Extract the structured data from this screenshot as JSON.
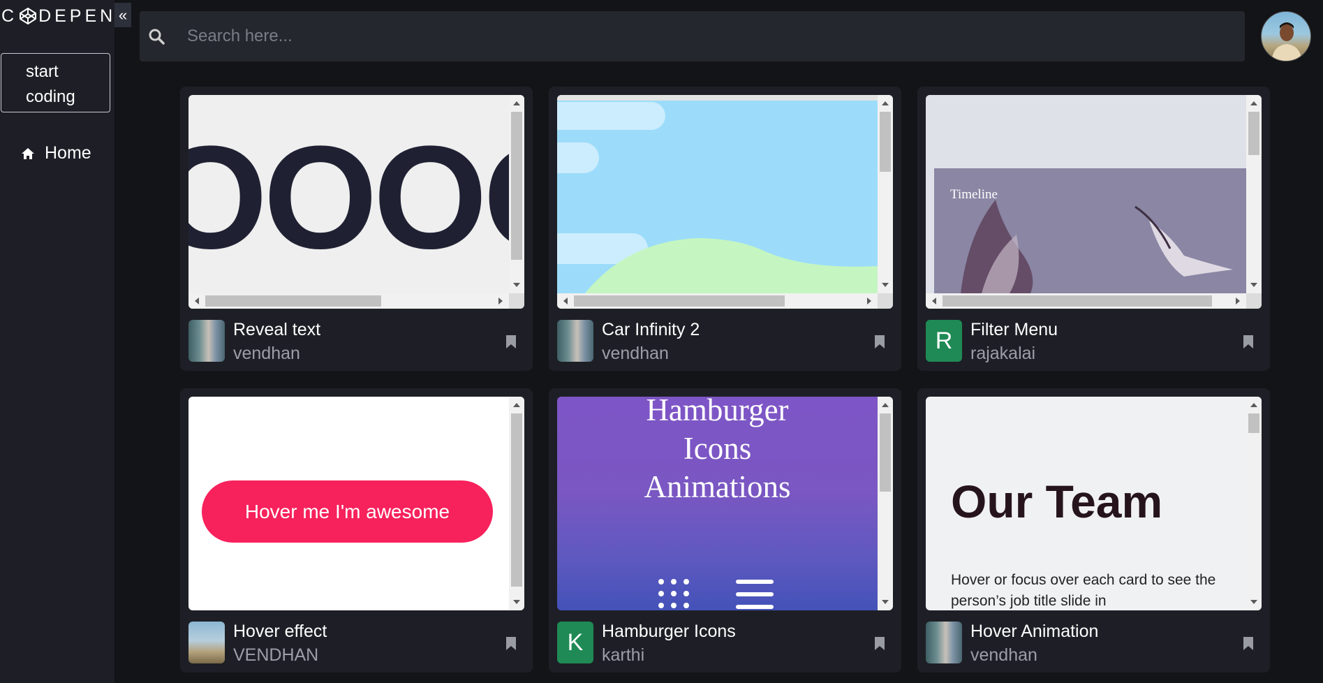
{
  "sidebar": {
    "logo": "C DEPEN",
    "logo_icon": "codepen-cube-icon",
    "collapse_label": "«",
    "start_button_line1": "start",
    "start_button_line2": "coding",
    "nav": [
      {
        "label": "Home",
        "icon": "home-icon"
      }
    ]
  },
  "search": {
    "placeholder": "Search here...",
    "icon": "search-icon"
  },
  "cards": [
    {
      "title": "Reveal text",
      "author": "vendhan",
      "avatar": "photo"
    },
    {
      "title": "Car Infinity 2",
      "author": "vendhan",
      "avatar": "photo"
    },
    {
      "title": "Filter Menu",
      "author": "rajakalai",
      "avatar_letter": "R",
      "avatar_color": "#1f8a55"
    },
    {
      "title": "Hover effect",
      "author": "VENDHAN",
      "avatar": "photo"
    },
    {
      "title": "Hamburger Icons",
      "author": "karthi",
      "avatar_letter": "K",
      "avatar_color": "#1f8a55"
    },
    {
      "title": "Hover Animation",
      "author": "vendhan",
      "avatar": "photo"
    }
  ],
  "previews": {
    "reveal_text": "OOOO",
    "filter_timeline": "Timeline",
    "hover_button": "Hover me I'm awesome",
    "hamburger_line1": "Hamburger",
    "hamburger_line2": "Icons",
    "hamburger_line3": "Animations",
    "team_heading": "Our Team",
    "team_text": "Hover or focus over each card to see the person’s job title slide in"
  },
  "colors": {
    "background": "#131417",
    "panel": "#1e1f26",
    "accent_pink": "#f7215c",
    "letter_avatar": "#1f8a55"
  }
}
